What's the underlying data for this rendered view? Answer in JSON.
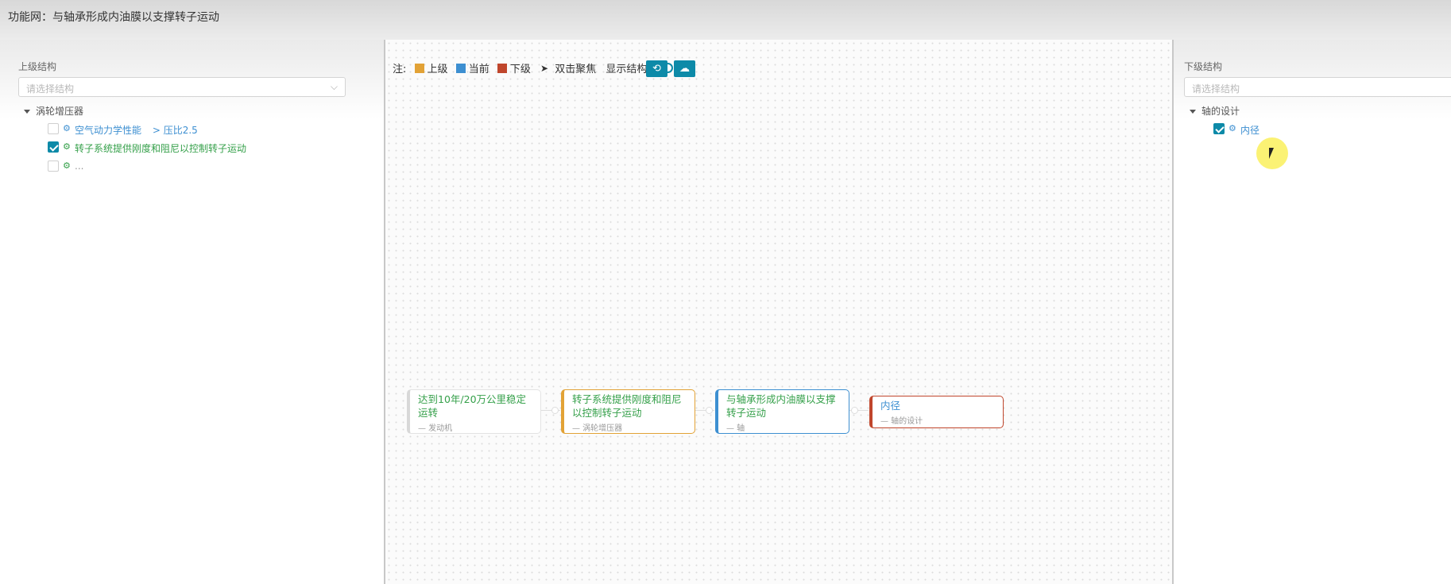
{
  "header": {
    "title": "功能网：与轴承形成内油膜以支撑转子运动"
  },
  "left": {
    "label": "上级结构",
    "select_placeholder": "请选择结构",
    "tree_root": "涡轮增压器",
    "items": [
      {
        "label": "空气动力学性能",
        "extra": "> 压比2.5",
        "checked": false
      },
      {
        "label": "转子系统提供刚度和阻尼以控制转子运动",
        "checked": true
      },
      {
        "label": "...",
        "checked": false
      }
    ]
  },
  "right": {
    "label": "下级结构",
    "select_placeholder": "请选择结构",
    "tree_root": "轴的设计",
    "items": [
      {
        "label": "内径",
        "checked": true
      }
    ]
  },
  "legend": {
    "note": "注:",
    "upper": "上级",
    "current": "当前",
    "lower": "下级",
    "dbl": "双击聚焦",
    "show_structure": "显示结构"
  },
  "colors": {
    "upper": "#e2a236",
    "current": "#3d8fd1",
    "lower": "#c0462c",
    "accent": "#0d8aa8",
    "green": "#35a04a"
  },
  "nodes": [
    {
      "title": "达到10年/20万公里稳定运转",
      "sub": "— 发动机",
      "role": "other"
    },
    {
      "title": "转子系统提供刚度和阻尼以控制转子运动",
      "sub": "— 涡轮增压器",
      "role": "upper"
    },
    {
      "title": "与轴承形成内油膜以支撑转子运动",
      "sub": "— 轴",
      "role": "current"
    },
    {
      "title": "内径",
      "sub": "— 轴的设计",
      "role": "lower"
    }
  ]
}
